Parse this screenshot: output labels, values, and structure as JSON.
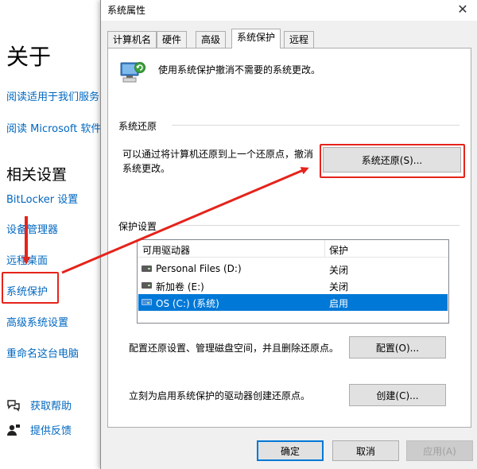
{
  "settings": {
    "about_heading": "关于",
    "links_top": [
      "阅读适用于我们服务",
      "阅读 Microsoft 软件"
    ],
    "related_heading": "相关设置",
    "related_links": [
      "BitLocker 设置",
      "设备管理器",
      "远程桌面",
      "系统保护",
      "高级系统设置",
      "重命名这台电脑"
    ],
    "help_items": [
      {
        "icon": "help-chat-icon",
        "label": "获取帮助"
      },
      {
        "icon": "feedback-person-icon",
        "label": "提供反馈"
      }
    ]
  },
  "dialog": {
    "title": "系统属性",
    "close_glyph": "✕",
    "tabs": [
      "计算机名",
      "硬件",
      "高级",
      "系统保护",
      "远程"
    ],
    "active_tab": "系统保护",
    "intro_text": "使用系统保护撤消不需要的系统更改。",
    "restore_group": {
      "label": "系统还原",
      "description_line1": "可以通过将计算机还原到上一个还原点，撤消",
      "description_line2": "系统更改。",
      "button": "系统还原(S)..."
    },
    "protection_group": {
      "label": "保护设置",
      "columns": [
        "可用驱动器",
        "保护"
      ],
      "drives": [
        {
          "name": "Personal Files (D:)",
          "protection": "关闭",
          "selected": false
        },
        {
          "name": "新加卷 (E:)",
          "protection": "关闭",
          "selected": false
        },
        {
          "name": "OS (C:) (系统)",
          "protection": "启用",
          "selected": true
        }
      ],
      "configure_text": "配置还原设置、管理磁盘空间，并且删除还原点。",
      "configure_button": "配置(O)...",
      "create_text": "立刻为启用系统保护的驱动器创建还原点。",
      "create_button": "创建(C)..."
    },
    "footer": {
      "ok": "确定",
      "cancel": "取消",
      "apply": "应用(A)"
    }
  },
  "colors": {
    "accent": "#0078d7",
    "link": "#0067c0",
    "annotation_red": "#e5231b"
  }
}
